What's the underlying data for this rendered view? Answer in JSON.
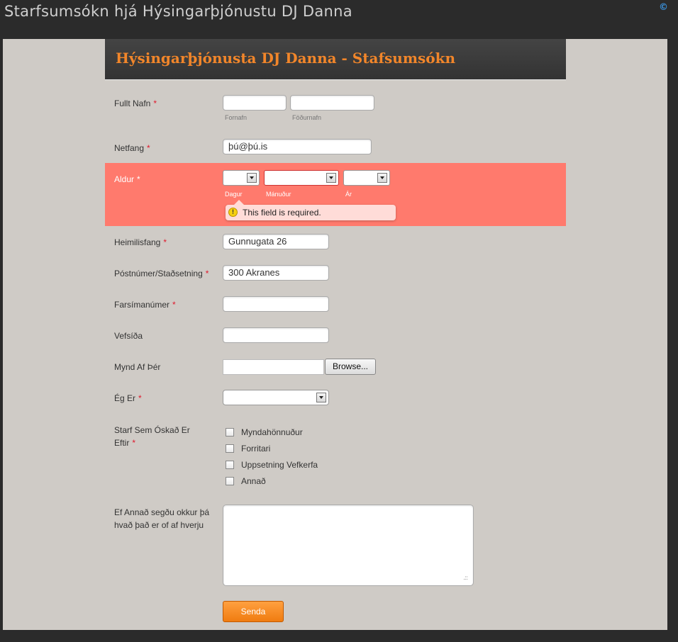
{
  "site": {
    "title": "Starfsumsókn hjá Hýsingarþjónustu DJ Danna",
    "copyright_symbol": "©"
  },
  "form": {
    "header": "Hýsingarþjónusta DJ Danna - Stafsumsókn",
    "required_marker": "*",
    "fields": {
      "full_name": {
        "label": "Fullt Nafn",
        "first_sublabel": "Fornafn",
        "last_sublabel": "Föðurnafn",
        "first_value": "",
        "last_value": ""
      },
      "email": {
        "label": "Netfang",
        "value": "þú@þú.is"
      },
      "age": {
        "label": "Aldur",
        "day_sublabel": "Dagur",
        "month_sublabel": "Mánuður",
        "year_sublabel": "Ár",
        "error": "This field is required."
      },
      "address": {
        "label": "Heimilisfang",
        "value": "Gunnugata 26"
      },
      "postal": {
        "label": "Póstnúmer/Staðsetning",
        "value": "300 Akranes"
      },
      "mobile": {
        "label": "Farsímanúmer",
        "value": ""
      },
      "website": {
        "label": "Vefsíða",
        "value": ""
      },
      "photo": {
        "label": "Mynd Af Þér",
        "browse_label": "Browse..."
      },
      "i_am": {
        "label": "Ég Er",
        "value": ""
      },
      "job": {
        "label_line1": "Starf Sem Óskað Er",
        "label_line2": "Eftir",
        "options": [
          "Myndahönnuður",
          "Forritari",
          "Uppsetning Vefkerfa",
          "Annað"
        ]
      },
      "other": {
        "label_line1": "Ef Annað segðu okkur þá",
        "label_line2": "hvað það er of af hverju"
      }
    },
    "submit_label": "Senda"
  },
  "colors": {
    "accent": "#f2862a",
    "error_background": "#ff7a6d",
    "required_star": "#e0192c"
  }
}
